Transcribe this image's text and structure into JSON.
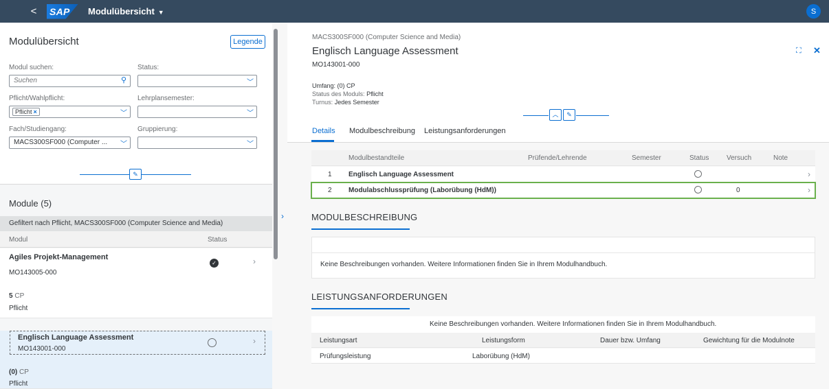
{
  "shell": {
    "back": "<",
    "logo": "SAP",
    "app_title": "Modulübersicht",
    "avatar": "S"
  },
  "left": {
    "title": "Modulübersicht",
    "legend_label": "Legende",
    "filters": {
      "search_label": "Modul suchen:",
      "search_placeholder": "Suchen",
      "status_label": "Status:",
      "status_value": "",
      "pflicht_label": "Pflicht/Wahlpflicht:",
      "pflicht_token": "Pflicht",
      "lehrplan_label": "Lehrplansemester:",
      "lehrplan_value": "",
      "fach_label": "Fach/Studiengang:",
      "fach_value": "MACS300SF000 (Computer ...",
      "gruppierung_label": "Gruppierung:",
      "gruppierung_value": ""
    },
    "list": {
      "count_title": "Module (5)",
      "filter_text": "Gefiltert nach Pflicht, MACS300SF000 (Computer Science and Media)",
      "col_modul": "Modul",
      "col_status": "Status",
      "items": [
        {
          "name": "Agiles Projekt-Management",
          "code": "MO143005-000",
          "cp_value": "5",
          "cp_unit": "CP",
          "type": "Pflicht",
          "status": "done"
        },
        {
          "name": "Englisch Language Assessment",
          "code": "MO143001-000",
          "cp_value": "(0)",
          "cp_unit": "CP",
          "type": "Pflicht",
          "status": "open"
        }
      ]
    }
  },
  "right": {
    "subtitle": "MACS300SF000 (Computer Science and Media)",
    "title": "Englisch Language Assessment",
    "code": "MO143001-000",
    "umfang": "Umfang: (0) CP",
    "status_key": "Status des Moduls:",
    "status_val": "Pflicht",
    "turnus_key": "Turnus:",
    "turnus_val": "Jedes Semester",
    "tabs": [
      "Details",
      "Modulbeschreibung",
      "Leistungsanforderungen"
    ],
    "table": {
      "headers": [
        "Modulbestandteile",
        "Prüfende/Lehrende",
        "Semester",
        "Status",
        "Versuch",
        "Note"
      ],
      "rows": [
        {
          "num": "1",
          "name": "Englisch Language Assessment",
          "versuch": ""
        },
        {
          "num": "2",
          "name": "Modulabschlussprüfung (Laborübung (HdM))",
          "versuch": "0"
        }
      ]
    },
    "sec_modul": "MODULBESCHREIBUNG",
    "sec_modul_msg": "Keine Beschreibungen vorhanden. Weitere Informationen finden Sie in Ihrem Modulhandbuch.",
    "sec_leist": "LEISTUNGSANFORDERUNGEN",
    "sec_leist_msg": "Keine Beschreibungen vorhanden. Weitere Informationen finden Sie in Ihrem Modulhandbuch.",
    "leist_headers": [
      "Leistungsart",
      "Leistungsform",
      "Dauer bzw. Umfang",
      "Gewichtung für die Modulnote"
    ],
    "leist_row": [
      "Prüfungsleistung",
      "Laborübung (HdM)"
    ]
  }
}
